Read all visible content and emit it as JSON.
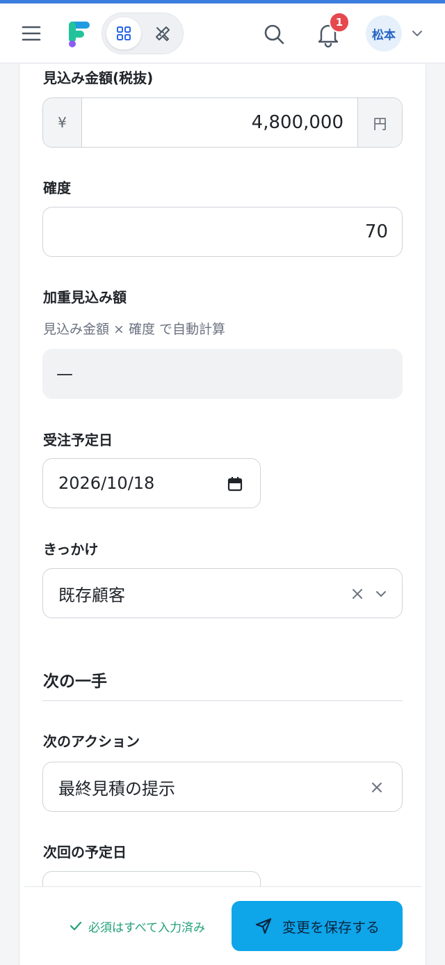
{
  "header": {
    "notification_count": "1",
    "user_initials": "松本"
  },
  "form": {
    "expected_amount": {
      "label": "見込み金額(税抜)",
      "prefix": "¥",
      "value": "4,800,000",
      "suffix": "円"
    },
    "probability": {
      "label": "確度",
      "value": "70"
    },
    "weighted_amount": {
      "label": "加重見込み額",
      "hint": "見込み金額 × 確度 で自動計算",
      "value": "—"
    },
    "close_date": {
      "label": "受注予定日",
      "value": "2026/10/18"
    },
    "trigger": {
      "label": "きっかけ",
      "value": "既存顧客"
    },
    "next_step_section": {
      "title": "次の一手"
    },
    "next_action": {
      "label": "次のアクション",
      "value": "最終見積の提示"
    },
    "next_date": {
      "label": "次回の予定日"
    }
  },
  "footer": {
    "status": "必須はすべて入力済み",
    "save_label": "変更を保存する"
  },
  "colors": {
    "accent": "#0ea5e9",
    "badge": "#e5484d",
    "success": "#22a07a"
  }
}
